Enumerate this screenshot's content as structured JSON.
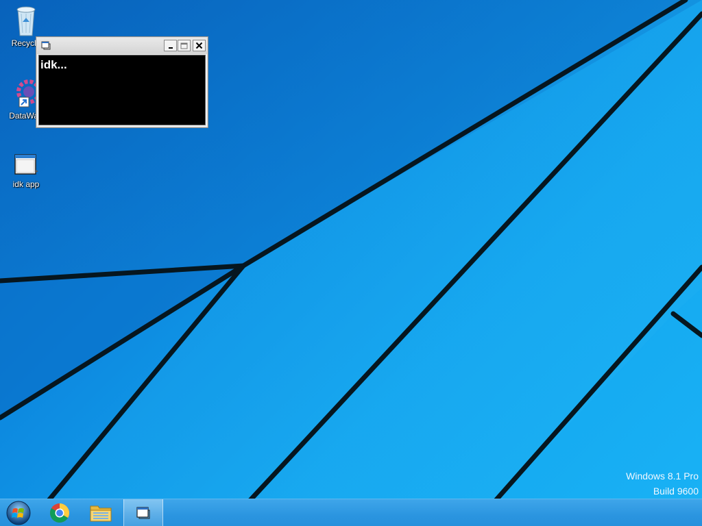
{
  "desktop": {
    "icons": [
      {
        "label": "Recycle",
        "icon": "recycle-bin-icon"
      },
      {
        "label": "DataWag",
        "icon": "datawag-gear-icon"
      },
      {
        "label": "idk app",
        "icon": "app-window-icon"
      }
    ]
  },
  "console_window": {
    "title": "",
    "output_text": "idk...",
    "buttons": {
      "minimize": "minimize-icon",
      "maximize": "maximize-icon",
      "close": "close-icon"
    }
  },
  "watermark": {
    "line1": "Windows 8.1 Pro",
    "line2": "Build 9600"
  },
  "taskbar": {
    "items": [
      {
        "name": "Start",
        "icon": "windows-start-orb-icon"
      },
      {
        "name": "Google Chrome",
        "icon": "chrome-icon"
      },
      {
        "name": "File Explorer",
        "icon": "file-explorer-icon"
      },
      {
        "name": "idk app",
        "icon": "app-window-icon",
        "active": true
      }
    ]
  },
  "colors": {
    "wallpaper_blue": "#1aa3ef",
    "wallpaper_lines": "#0a1a22",
    "console_bg": "#000000",
    "console_text": "#ffffff",
    "taskbar": "#2b95e0"
  }
}
